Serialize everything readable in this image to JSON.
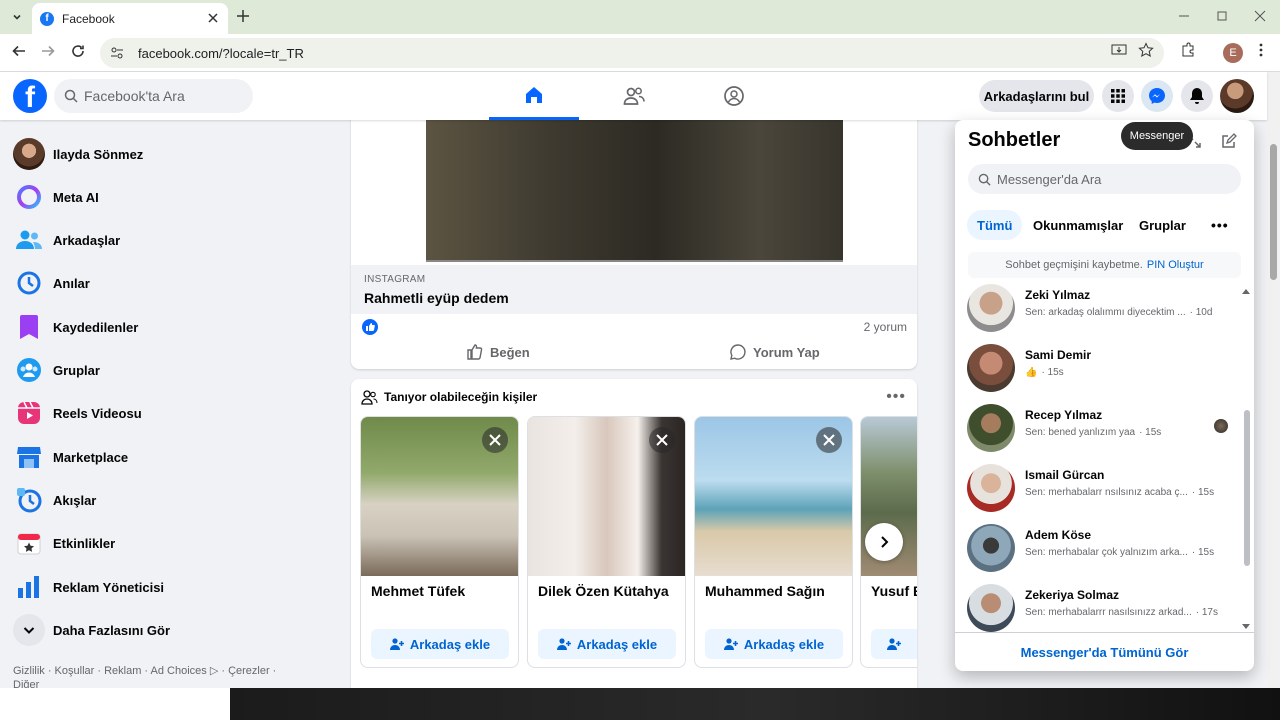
{
  "browser": {
    "tab_title": "Facebook",
    "url": "facebook.com/?locale=tr_TR",
    "profile_initial": "E"
  },
  "header": {
    "search_placeholder": "Facebook'ta Ara",
    "find_friends": "Arkadaşlarını bul"
  },
  "sidebar": {
    "items": [
      {
        "label": "Ilayda Sönmez",
        "icon": "profile-avatar"
      },
      {
        "label": "Meta AI",
        "icon": "meta-ai-icon"
      },
      {
        "label": "Arkadaşlar",
        "icon": "friends-icon"
      },
      {
        "label": "Anılar",
        "icon": "memories-icon"
      },
      {
        "label": "Kaydedilenler",
        "icon": "saved-icon"
      },
      {
        "label": "Gruplar",
        "icon": "groups-icon"
      },
      {
        "label": "Reels Videosu",
        "icon": "reels-icon"
      },
      {
        "label": "Marketplace",
        "icon": "marketplace-icon"
      },
      {
        "label": "Akışlar",
        "icon": "feeds-icon"
      },
      {
        "label": "Etkinlikler",
        "icon": "events-icon"
      },
      {
        "label": "Reklam Yöneticisi",
        "icon": "ads-manager-icon"
      },
      {
        "label": "Daha Fazlasını Gör",
        "icon": "chevron-down-icon"
      }
    ],
    "footer": "Gizlilik · Koşullar · Reklam · Ad Choices ▷ · Çerezler · Diğer"
  },
  "post": {
    "link_source": "INSTAGRAM",
    "link_title": "Rahmetli eyüp dedem",
    "comments": "2 yorum",
    "like_label": "Beğen",
    "comment_label": "Yorum Yap"
  },
  "pymk": {
    "title": "Tanıyor olabileceğin kişiler",
    "add_label": "Arkadaş ekle",
    "people": [
      {
        "name": "Mehmet Tüfek"
      },
      {
        "name": "Dilek Özen Kütahya"
      },
      {
        "name": "Muhammed Sağın"
      },
      {
        "name": "Yusuf B"
      }
    ]
  },
  "messenger": {
    "title": "Sohbetler",
    "tooltip": "Messenger",
    "search_placeholder": "Messenger'da Ara",
    "filters": [
      "Tümü",
      "Okunmamışlar",
      "Gruplar"
    ],
    "pin_text": "Sohbet geçmişini kaybetme.",
    "pin_link": "PIN Oluştur",
    "conversations": [
      {
        "name": "Zeki Yılmaz",
        "preview": "Sen: arkadaş olalımmı diyecektim ...",
        "time": "· 10d"
      },
      {
        "name": "Sami Demir",
        "preview": "👍",
        "time": "· 15s"
      },
      {
        "name": "Recep Yılmaz",
        "preview": "Sen: bened yanlızım yaa",
        "time": "· 15s"
      },
      {
        "name": "Ismail Gürcan",
        "preview": "Sen: merhabalarr nsılsınız acaba ç...",
        "time": "· 15s"
      },
      {
        "name": "Adem Köse",
        "preview": "Sen: merhabalar çok yalnızım arka...",
        "time": "· 15s"
      },
      {
        "name": "Zekeriya Solmaz",
        "preview": "Sen: merhabalarrr nasılsınızz arkad...",
        "time": "· 17s"
      }
    ],
    "see_all": "Messenger'da Tümünü Gör"
  },
  "colors": {
    "brand": "#0866ff",
    "link": "#0064d1"
  }
}
